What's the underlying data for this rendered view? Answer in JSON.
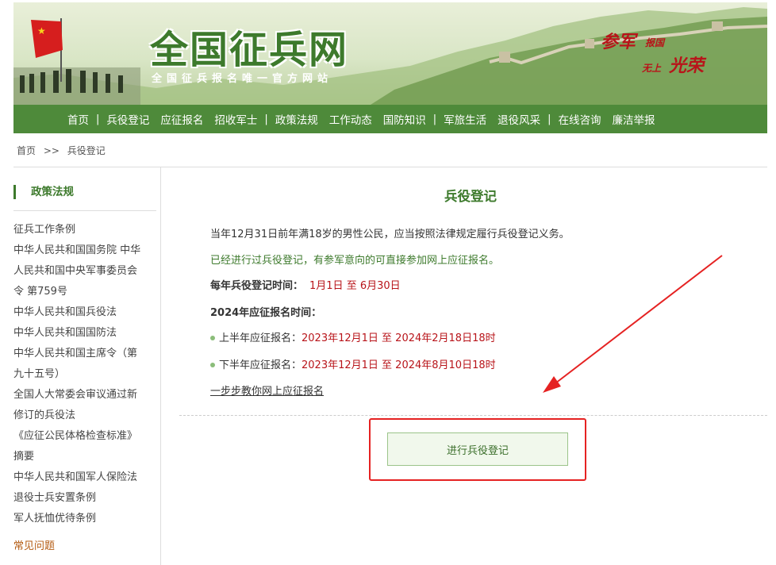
{
  "banner": {
    "title": "全国征兵网",
    "subtitle": "全国征兵报名唯一官方网站",
    "slogan": {
      "a": "参军",
      "b": "报国",
      "c": "无上",
      "d": "光荣"
    }
  },
  "nav": {
    "items": [
      "首页",
      "兵役登记",
      "应征报名",
      "招收军士",
      "政策法规",
      "工作动态",
      "国防知识",
      "军旅生活",
      "退役风采",
      "在线咨询",
      "廉洁举报"
    ],
    "separator": "|"
  },
  "breadcrumb": {
    "home": "首页",
    "sep": ">>",
    "current": "兵役登记"
  },
  "sidebar": {
    "title": "政策法规",
    "items": [
      "征兵工作条例",
      "中华人民共和国国务院 中华",
      "人民共和国中央军事委员会",
      "令 第759号",
      "中华人民共和国兵役法",
      "中华人民共和国国防法",
      "中华人民共和国主席令（第",
      "九十五号）",
      "全国人大常委会审议通过新",
      "修订的兵役法",
      "《应征公民体格检查标准》",
      "摘要",
      "中华人民共和国军人保险法",
      "退役士兵安置条例",
      "军人抚恤优待条例"
    ],
    "faq": "常见问题"
  },
  "main": {
    "title": "兵役登记",
    "p1": "当年12月31日前年满18岁的男性公民，应当按照法律规定履行兵役登记义务。",
    "p2": "已经进行过兵役登记，有参军意向的可直接参加网上应征报名。",
    "reg_label": "每年兵役登记时间：",
    "reg_time": "1月1日 至 6月30日",
    "enlist_label": "2024年应征报名时间：",
    "h1_label": "上半年应征报名：",
    "h1_time": "2023年12月1日 至 2024年2月18日18时",
    "h2_label": "下半年应征报名：",
    "h2_time": "2023年12月1日 至 2024年8月10日18时",
    "guide": "一步步教你网上应征报名",
    "button": "进行兵役登记"
  },
  "colors": {
    "brand_green": "#4e8a3a",
    "title_green": "#3d7a2c",
    "highlight_red": "#e52222",
    "time_red": "#b8141a"
  }
}
